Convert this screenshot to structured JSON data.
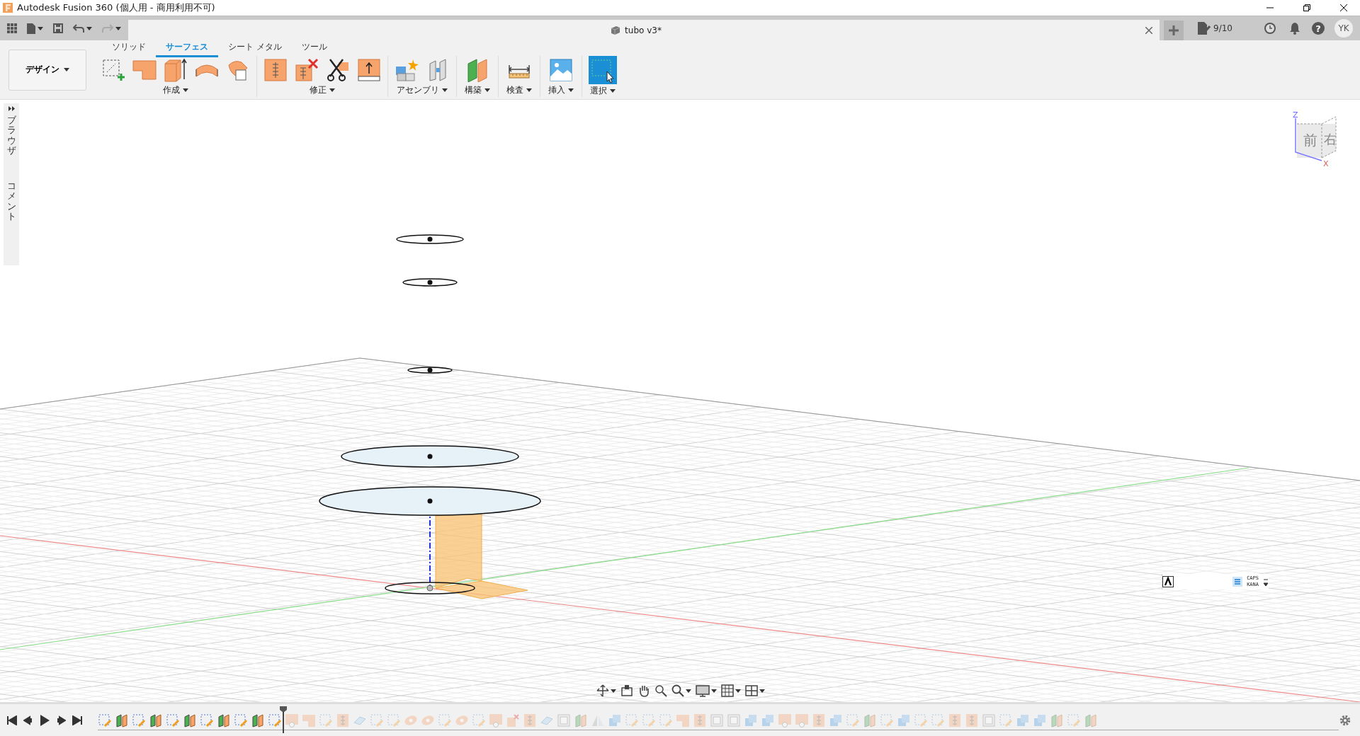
{
  "window": {
    "title": "Autodesk Fusion 360 (個人用 - 商用利用不可)"
  },
  "document_tab": {
    "title": "tubo v3*"
  },
  "job_status": {
    "count": "9/10"
  },
  "help": {
    "glyph": "?"
  },
  "user": {
    "initials": "YK"
  },
  "workspace": {
    "label": "デザイン"
  },
  "tabs": [
    {
      "label": "ソリッド",
      "selected": false
    },
    {
      "label": "サーフェス",
      "selected": true
    },
    {
      "label": "シート メタル",
      "selected": false
    },
    {
      "label": "ツール",
      "selected": false
    }
  ],
  "toolbar_groups": [
    {
      "label": "作成",
      "tools": [
        {
          "kind": "sketch"
        },
        {
          "kind": "patch"
        },
        {
          "kind": "extrude"
        },
        {
          "kind": "revolve"
        },
        {
          "kind": "boundary"
        }
      ]
    },
    {
      "label": "修正",
      "tools": [
        {
          "kind": "extend"
        },
        {
          "kind": "delete"
        },
        {
          "kind": "trim"
        },
        {
          "kind": "offset"
        }
      ]
    },
    {
      "label": "アセンブリ",
      "tools": [
        {
          "kind": "component"
        },
        {
          "kind": "joint"
        }
      ]
    },
    {
      "label": "構築",
      "tools": [
        {
          "kind": "plane"
        }
      ]
    },
    {
      "label": "検査",
      "tools": [
        {
          "kind": "measure"
        }
      ]
    },
    {
      "label": "挿入",
      "tools": [
        {
          "kind": "image"
        }
      ]
    },
    {
      "label": "選択",
      "tools": [
        {
          "kind": "select"
        }
      ]
    }
  ],
  "side_panel": [
    {
      "label": "ブラウザ",
      "kind": "browser"
    },
    {
      "label": "コメント",
      "kind": "comments"
    }
  ],
  "view_cube": {
    "front": "前",
    "right": "右",
    "z_axis": "Z",
    "x_axis": "X"
  },
  "ime_bar": {
    "caps": "CAPS",
    "kana": "KANA"
  },
  "timeline": {
    "features": [
      {
        "kind": "sketch",
        "rolled_back": false
      },
      {
        "kind": "surface",
        "rolled_back": false
      },
      {
        "kind": "sketch",
        "rolled_back": false
      },
      {
        "kind": "surface",
        "rolled_back": false
      },
      {
        "kind": "sketch",
        "rolled_back": false
      },
      {
        "kind": "surface",
        "rolled_back": false
      },
      {
        "kind": "sketch",
        "rolled_back": false
      },
      {
        "kind": "surface",
        "rolled_back": false
      },
      {
        "kind": "sketch",
        "rolled_back": false
      },
      {
        "kind": "surface",
        "rolled_back": false
      },
      {
        "kind": "sketch",
        "rolled_back": false
      },
      {
        "kind": "patch",
        "rolled_back": true
      },
      {
        "kind": "boundary",
        "rolled_back": true
      },
      {
        "kind": "sketch",
        "rolled_back": true
      },
      {
        "kind": "extend",
        "rolled_back": true
      },
      {
        "kind": "stitch",
        "rolled_back": true
      },
      {
        "kind": "sketch",
        "rolled_back": true
      },
      {
        "kind": "sketch",
        "rolled_back": true
      },
      {
        "kind": "loft",
        "rolled_back": true
      },
      {
        "kind": "loft",
        "rolled_back": true
      },
      {
        "kind": "sketch",
        "rolled_back": true
      },
      {
        "kind": "loft",
        "rolled_back": true
      },
      {
        "kind": "sketch",
        "rolled_back": true
      },
      {
        "kind": "patch",
        "rolled_back": true
      },
      {
        "kind": "delete",
        "rolled_back": true
      },
      {
        "kind": "extend",
        "rolled_back": true
      },
      {
        "kind": "stitch",
        "rolled_back": true
      },
      {
        "kind": "box",
        "rolled_back": true
      },
      {
        "kind": "surface",
        "rolled_back": true
      },
      {
        "kind": "mirror",
        "rolled_back": true
      },
      {
        "kind": "combine",
        "rolled_back": true
      },
      {
        "kind": "sketch",
        "rolled_back": true
      },
      {
        "kind": "sketch",
        "rolled_back": true
      },
      {
        "kind": "sketch",
        "rolled_back": true
      },
      {
        "kind": "boundary",
        "rolled_back": true
      },
      {
        "kind": "extend",
        "rolled_back": true
      },
      {
        "kind": "box",
        "rolled_back": true
      },
      {
        "kind": "box",
        "rolled_back": true
      },
      {
        "kind": "combine",
        "rolled_back": true
      },
      {
        "kind": "combine",
        "rolled_back": true
      },
      {
        "kind": "patch",
        "rolled_back": true
      },
      {
        "kind": "patch",
        "rolled_back": true
      },
      {
        "kind": "extend",
        "rolled_back": true
      },
      {
        "kind": "combine",
        "rolled_back": true
      },
      {
        "kind": "sketch",
        "rolled_back": true
      },
      {
        "kind": "surface",
        "rolled_back": true
      },
      {
        "kind": "sketch",
        "rolled_back": true
      },
      {
        "kind": "combine",
        "rolled_back": true
      },
      {
        "kind": "sketch",
        "rolled_back": true
      },
      {
        "kind": "sketch",
        "rolled_back": true
      },
      {
        "kind": "extend",
        "rolled_back": true
      },
      {
        "kind": "extend",
        "rolled_back": true
      },
      {
        "kind": "box",
        "rolled_back": true
      },
      {
        "kind": "sketch",
        "rolled_back": true
      },
      {
        "kind": "combine",
        "rolled_back": true
      },
      {
        "kind": "combine",
        "rolled_back": true
      },
      {
        "kind": "surface",
        "rolled_back": true
      },
      {
        "kind": "sketch",
        "rolled_back": true
      },
      {
        "kind": "surface",
        "rolled_back": true
      }
    ]
  }
}
